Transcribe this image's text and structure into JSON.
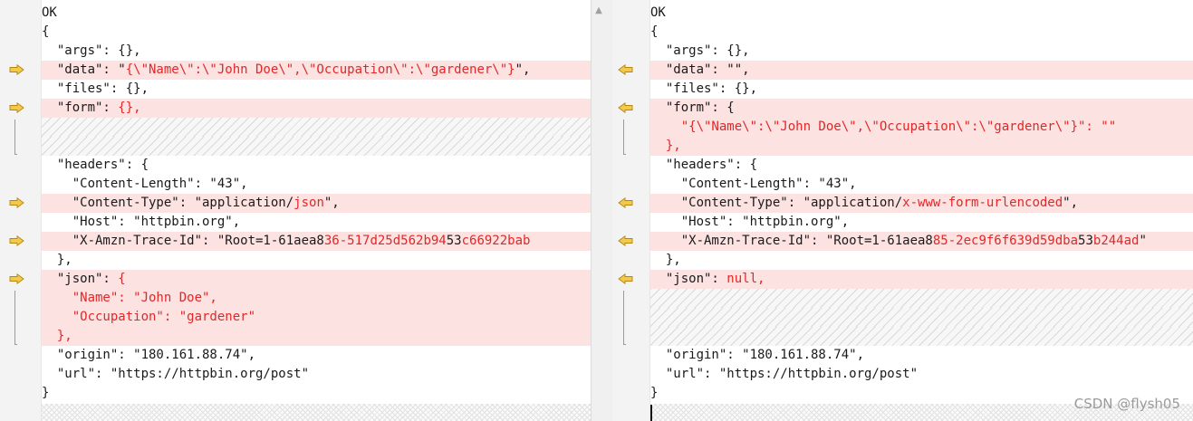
{
  "left": {
    "lines": [
      {
        "t": "plain",
        "segs": [
          "OK"
        ]
      },
      {
        "t": "plain",
        "segs": [
          "{"
        ]
      },
      {
        "t": "plain",
        "segs": [
          "  \"args\": {},"
        ]
      },
      {
        "t": "changed",
        "arrow": true,
        "segs": [
          "  \"data\": \"",
          {
            "h": "{\\\"Name\\\":\\\"John Doe\\\",\\\"Occupation\\\":\\\"gardener\\\"}"
          },
          "\","
        ]
      },
      {
        "t": "plain",
        "segs": [
          "  \"files\": {},"
        ]
      },
      {
        "t": "changed",
        "arrow": true,
        "segs": [
          "  \"form\": ",
          {
            "h": "{},"
          }
        ]
      },
      {
        "t": "blank",
        "segs": []
      },
      {
        "t": "blank",
        "segs": []
      },
      {
        "t": "plain",
        "segs": [
          "  \"headers\": {"
        ]
      },
      {
        "t": "plain",
        "segs": [
          "    \"Content-Length\": \"43\","
        ]
      },
      {
        "t": "changed",
        "arrow": true,
        "segs": [
          "    \"Content-Type\": \"application/",
          {
            "h": "json"
          },
          "\","
        ]
      },
      {
        "t": "plain",
        "segs": [
          "    \"Host\": \"httpbin.org\","
        ]
      },
      {
        "t": "changed",
        "arrow": true,
        "segs": [
          "    \"X-Amzn-Trace-Id\": \"Root=1-61aea8",
          {
            "h": "36-517d25d562b94"
          },
          "53",
          {
            "h": "c66922bab"
          }
        ]
      },
      {
        "t": "plain",
        "segs": [
          "  },"
        ]
      },
      {
        "t": "changed",
        "arrow": true,
        "segs": [
          "  \"json\": ",
          {
            "h": "{"
          }
        ]
      },
      {
        "t": "changed",
        "segs": [
          {
            "h": "    \"Name\": \"John Doe\","
          }
        ]
      },
      {
        "t": "changed",
        "segs": [
          {
            "h": "    \"Occupation\": \"gardener\""
          }
        ]
      },
      {
        "t": "changed",
        "segs": [
          {
            "h": "  },"
          }
        ]
      },
      {
        "t": "plain",
        "segs": [
          "  \"origin\": \"180.161.88.74\","
        ]
      },
      {
        "t": "plain",
        "segs": [
          "  \"url\": \"https://httpbin.org/post\""
        ]
      },
      {
        "t": "plain",
        "segs": [
          "}"
        ]
      }
    ]
  },
  "right": {
    "lines": [
      {
        "t": "plain",
        "segs": [
          "OK"
        ]
      },
      {
        "t": "plain",
        "segs": [
          "{"
        ]
      },
      {
        "t": "plain",
        "segs": [
          "  \"args\": {},"
        ]
      },
      {
        "t": "changed",
        "arrow": true,
        "segs": [
          "  \"data\": \"\","
        ]
      },
      {
        "t": "plain",
        "segs": [
          "  \"files\": {},"
        ]
      },
      {
        "t": "changed",
        "arrow": true,
        "segs": [
          "  \"form\": {"
        ]
      },
      {
        "t": "changed",
        "segs": [
          {
            "h": "    \"{\\\"Name\\\":\\\"John Doe\\\",\\\"Occupation\\\":\\\"gardener\\\"}\": \"\""
          }
        ]
      },
      {
        "t": "changed",
        "segs": [
          {
            "h": "  },"
          }
        ]
      },
      {
        "t": "plain",
        "segs": [
          "  \"headers\": {"
        ]
      },
      {
        "t": "plain",
        "segs": [
          "    \"Content-Length\": \"43\","
        ]
      },
      {
        "t": "changed",
        "arrow": true,
        "segs": [
          "    \"Content-Type\": \"application/",
          {
            "h": "x-www-form-urlencoded"
          },
          "\","
        ]
      },
      {
        "t": "plain",
        "segs": [
          "    \"Host\": \"httpbin.org\","
        ]
      },
      {
        "t": "changed",
        "arrow": true,
        "segs": [
          "    \"X-Amzn-Trace-Id\": \"Root=1-61aea8",
          {
            "h": "85-2ec9f6f639d59dba"
          },
          "53",
          {
            "h": "b244ad"
          },
          "\""
        ]
      },
      {
        "t": "plain",
        "segs": [
          "  },"
        ]
      },
      {
        "t": "changed",
        "arrow": true,
        "segs": [
          "  \"json\": ",
          {
            "h": "null,"
          }
        ]
      },
      {
        "t": "blank",
        "segs": []
      },
      {
        "t": "blank",
        "segs": []
      },
      {
        "t": "blank",
        "segs": []
      },
      {
        "t": "plain",
        "segs": [
          "  \"origin\": \"180.161.88.74\","
        ]
      },
      {
        "t": "plain",
        "segs": [
          "  \"url\": \"https://httpbin.org/post\""
        ]
      },
      {
        "t": "plain",
        "segs": [
          "}"
        ]
      }
    ]
  },
  "colors": {
    "changed_bg": "#fde2e2",
    "highlight": "#e02828",
    "arrow_fill": "#f2c94c",
    "arrow_stroke": "#b8860b"
  },
  "icons": {
    "left_arrow": "arrow-right-icon",
    "right_arrow": "arrow-left-icon",
    "scroll_up": "chevron-up-icon"
  },
  "scrollbar": {
    "up_glyph": "▲"
  },
  "watermark": "CSDN @flysh05"
}
